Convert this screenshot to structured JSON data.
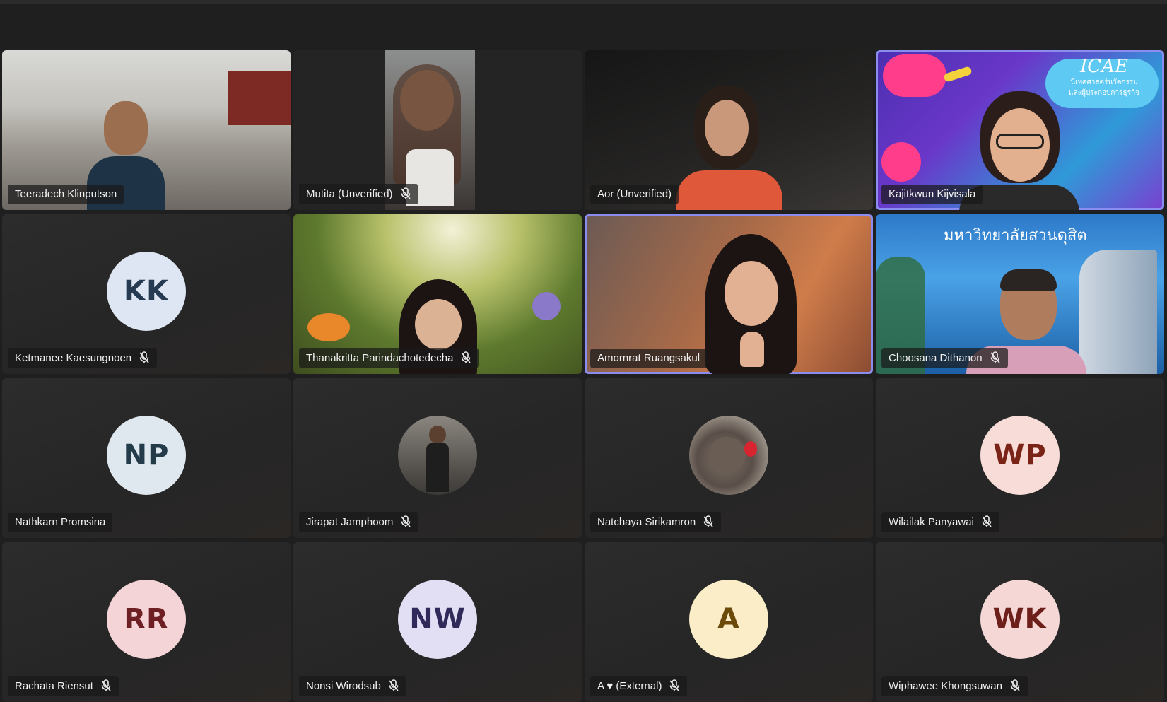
{
  "colors": {
    "background": "#1f1f1f",
    "speaking_outline": "#8b8cf0"
  },
  "participants": [
    {
      "name": "Teeradech Klinputson",
      "muted": false,
      "video": true
    },
    {
      "name": "Mutita (Unverified)",
      "muted": true,
      "video": true
    },
    {
      "name": "Aor (Unverified)",
      "muted": false,
      "video": true
    },
    {
      "name": "Kajitkwun Kijvisala",
      "muted": false,
      "video": true,
      "speaking": true,
      "background_text": [
        "ICAE",
        "นิเทศศาสตร์นวัตกรรม",
        "และผู้ประกอบการธุรกิจ"
      ]
    },
    {
      "name": "Ketmanee Kaesungnoen",
      "muted": true,
      "video": false,
      "initials": "KK",
      "avatar_bg": "#dde6f2",
      "avatar_fg": "#263a52"
    },
    {
      "name": "Thanakritta Parindachotedecha",
      "muted": true,
      "video": true
    },
    {
      "name": "Amornrat Ruangsakul",
      "muted": false,
      "video": true,
      "speaking": true
    },
    {
      "name": "Choosana Dithanon",
      "muted": true,
      "video": true,
      "background_text": "มหาวิทยาลัยสวนดุสิต"
    },
    {
      "name": "Nathkarn Promsina",
      "muted": false,
      "video": false,
      "initials": "NP",
      "avatar_bg": "#dfe8ee",
      "avatar_fg": "#243b4a"
    },
    {
      "name": "Jirapat Jamphoom",
      "muted": true,
      "video": false,
      "photo_avatar": "person-photo"
    },
    {
      "name": "Natchaya Sirikamron",
      "muted": true,
      "video": false,
      "photo_avatar": "kitten-photo"
    },
    {
      "name": "Wilailak Panyawai",
      "muted": true,
      "video": false,
      "initials": "WP",
      "avatar_bg": "#f8dcd8",
      "avatar_fg": "#7a2418"
    },
    {
      "name": "Rachata Riensut",
      "muted": true,
      "video": false,
      "initials": "RR",
      "avatar_bg": "#f4d4d6",
      "avatar_fg": "#6e1f24"
    },
    {
      "name": "Nonsi Wirodsub",
      "muted": true,
      "video": false,
      "initials": "NW",
      "avatar_bg": "#e2def4",
      "avatar_fg": "#2f2a5a"
    },
    {
      "name": "A ♥ (External)",
      "muted": true,
      "video": false,
      "initials": "A",
      "avatar_bg": "#faedc8",
      "avatar_fg": "#6b4b0a"
    },
    {
      "name": "Wiphawee Khongsuwan",
      "muted": true,
      "video": false,
      "initials": "WK",
      "avatar_bg": "#f5d8d6",
      "avatar_fg": "#6d1f1a"
    }
  ]
}
